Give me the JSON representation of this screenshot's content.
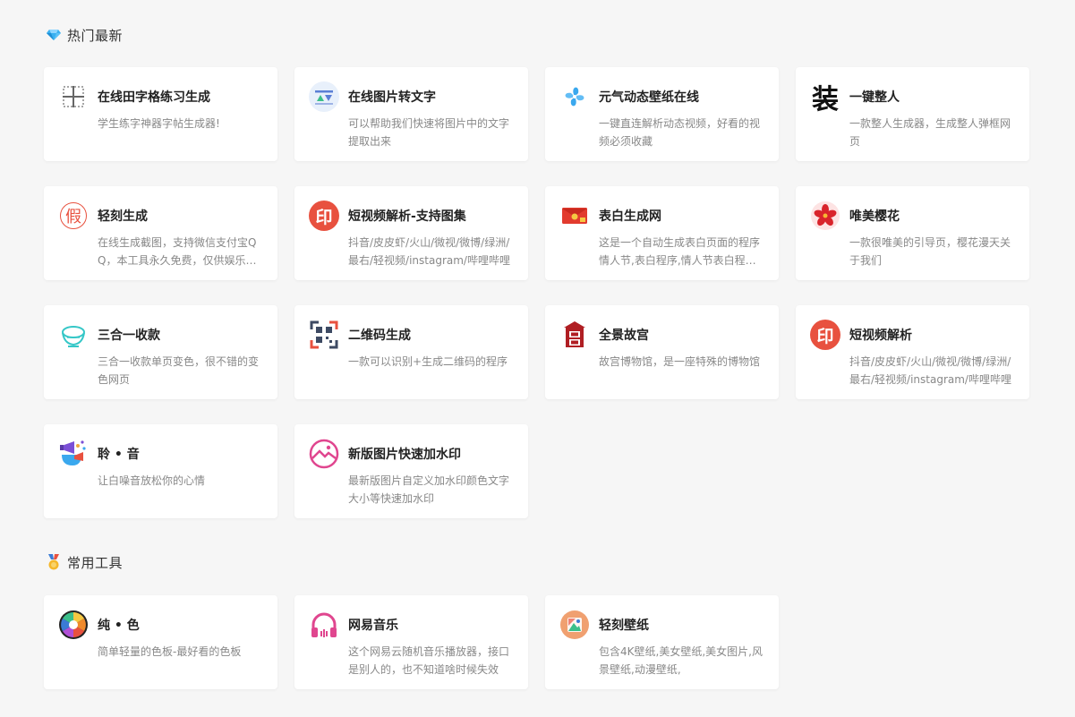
{
  "sections": [
    {
      "icon": "diamond-icon",
      "title": "热门最新",
      "cards": [
        {
          "icon": "grid-character-icon",
          "title": "在线田字格练习生成",
          "desc": "学生练字神器字帖生成器!"
        },
        {
          "icon": "image-to-text-icon",
          "title": "在线图片转文字",
          "desc": "可以帮助我们快速将图片中的文字提取出来"
        },
        {
          "icon": "pinwheel-icon",
          "title": "元气动态壁纸在线",
          "desc": "一键直连解析动态视频，好看的视频必须收藏"
        },
        {
          "icon": "zhuang-character-icon",
          "title": "一键整人",
          "desc": "一款整人生成器，生成整人弹框网页"
        },
        {
          "icon": "jia-seal-icon",
          "title": "轻刻生成",
          "desc": "在线生成截图，支持微信支付宝QQ，本工具永久免费，仅供娱乐使用"
        },
        {
          "icon": "yin-red-icon",
          "title": "短视频解析-支持图集",
          "desc": "抖音/皮皮虾/火山/微视/微博/绿洲/最右/轻视频/instagram/哔哩哔哩"
        },
        {
          "icon": "red-envelope-icon",
          "title": "表白生成网",
          "desc": "这是一个自动生成表白页面的程序情人节,表白程序,情人节表白程序网页"
        },
        {
          "icon": "sakura-icon",
          "title": "唯美樱花",
          "desc": "一款很唯美的引导页，樱花漫天关于我们"
        },
        {
          "icon": "rice-bowl-icon",
          "title": "三合一收款",
          "desc": "三合一收款单页变色，很不错的变色网页"
        },
        {
          "icon": "qrcode-icon",
          "title": "二维码生成",
          "desc": "一款可以识别+生成二维码的程序"
        },
        {
          "icon": "palace-icon",
          "title": "全景故宫",
          "desc": "故宫博物馆，是一座特殊的博物馆"
        },
        {
          "icon": "yin-red-icon",
          "title": "短视频解析",
          "desc": "抖音/皮皮虾/火山/微视/微博/绿洲/最右/轻视频/instagram/哔哩哔哩"
        },
        {
          "icon": "megaphone-icon",
          "title": "聆 • 音",
          "desc": "让白噪音放松你的心情"
        },
        {
          "icon": "watermark-image-icon",
          "title": "新版图片快速加水印",
          "desc": "最新版图片自定义加水印颜色文字大小等快速加水印"
        }
      ]
    },
    {
      "icon": "medal-icon",
      "title": "常用工具",
      "cards": [
        {
          "icon": "color-wheel-icon",
          "title": "纯 • 色",
          "desc": "简单轻量的色板-最好看的色板"
        },
        {
          "icon": "headphones-icon",
          "title": "网易音乐",
          "desc": "这个网易云随机音乐播放器，接口是别人的，也不知道啥时候失效"
        },
        {
          "icon": "wallpaper-icon",
          "title": "轻刻壁纸",
          "desc": "包含4K壁纸,美女壁纸,美女图片,风景壁纸,动漫壁纸,"
        }
      ]
    }
  ],
  "icon_glyphs": {
    "zhuang": "装",
    "jia": "假",
    "yin": "印"
  },
  "colors": {
    "background": "#f6f6f6",
    "card": "#ffffff",
    "title": "#222222",
    "desc": "#888888",
    "red": "#e8513f"
  }
}
